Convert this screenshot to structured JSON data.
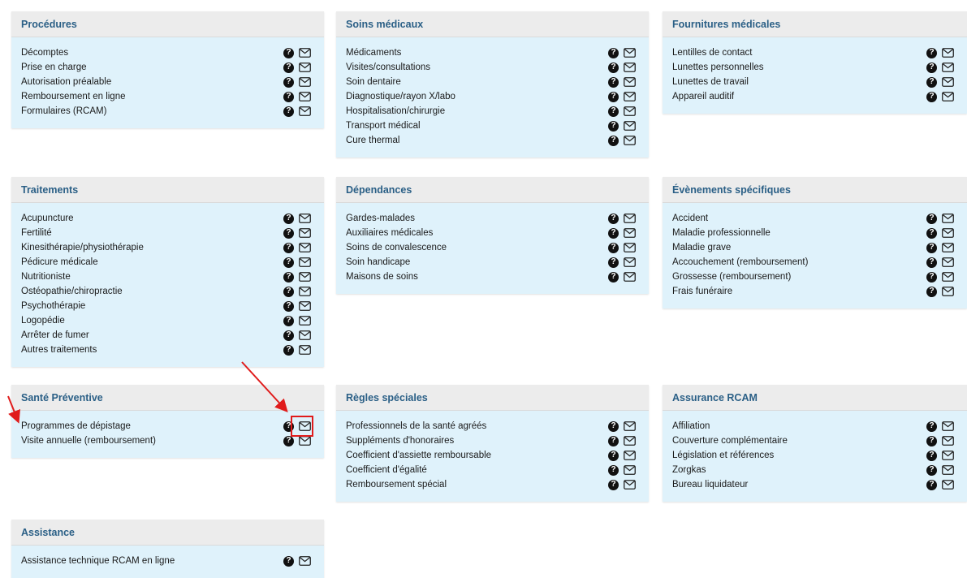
{
  "panels": [
    {
      "title": "Procédures",
      "items": [
        "Décomptes",
        "Prise en charge",
        "Autorisation préalable",
        "Remboursement en ligne",
        "Formulaires (RCAM)"
      ]
    },
    {
      "title": "Soins médicaux",
      "items": [
        "Médicaments",
        "Visites/consultations",
        "Soin dentaire",
        "Diagnostique/rayon X/labo",
        "Hospitalisation/chirurgie",
        "Transport médical",
        "Cure thermal"
      ]
    },
    {
      "title": "Fournitures médicales",
      "items": [
        "Lentilles de contact",
        "Lunettes personnelles",
        "Lunettes de travail",
        "Appareil auditif"
      ]
    },
    {
      "title": "Traitements",
      "items": [
        "Acupuncture",
        "Fertilité",
        "Kinesithérapie/physiothérapie",
        "Pédicure médicale",
        "Nutritioniste",
        "Ostéopathie/chiropractie",
        "Psychothérapie",
        "Logopédie",
        "Arrêter de fumer",
        "Autres traitements"
      ]
    },
    {
      "title": "Dépendances",
      "items": [
        "Gardes-malades",
        "Auxiliaires médicales",
        "Soins de convalescence",
        "Soin handicape",
        "Maisons de soins"
      ]
    },
    {
      "title": "Évènements spécifiques",
      "items": [
        "Accident",
        "Maladie professionnelle",
        "Maladie grave",
        "Accouchement (remboursement)",
        "Grossesse (remboursement)",
        "Frais funéraire"
      ]
    },
    {
      "title": "Santé Préventive",
      "items": [
        "Programmes de dépistage",
        "Visite annuelle (remboursement)"
      ]
    },
    {
      "title": "Règles spéciales",
      "items": [
        "Professionnels de la santé agréés",
        "Suppléments d'honoraires",
        "Coefficient d'assiette remboursable",
        "Coefficient d'égalité",
        "Remboursement spécial"
      ]
    },
    {
      "title": "Assurance RCAM",
      "items": [
        "Affiliation",
        "Couverture complémentaire",
        "Législation et références",
        "Zorgkas",
        "Bureau liquidateur"
      ]
    },
    {
      "title": "Assistance",
      "items": [
        "Assistance technique RCAM en ligne"
      ]
    }
  ],
  "icons": {
    "help": "question-circle-icon",
    "contact": "envelope-icon",
    "help_glyph": "?"
  },
  "colors": {
    "panel_bg": "#dff2fb",
    "header_text": "#2a5f86",
    "annotation": "#e01b1b"
  }
}
